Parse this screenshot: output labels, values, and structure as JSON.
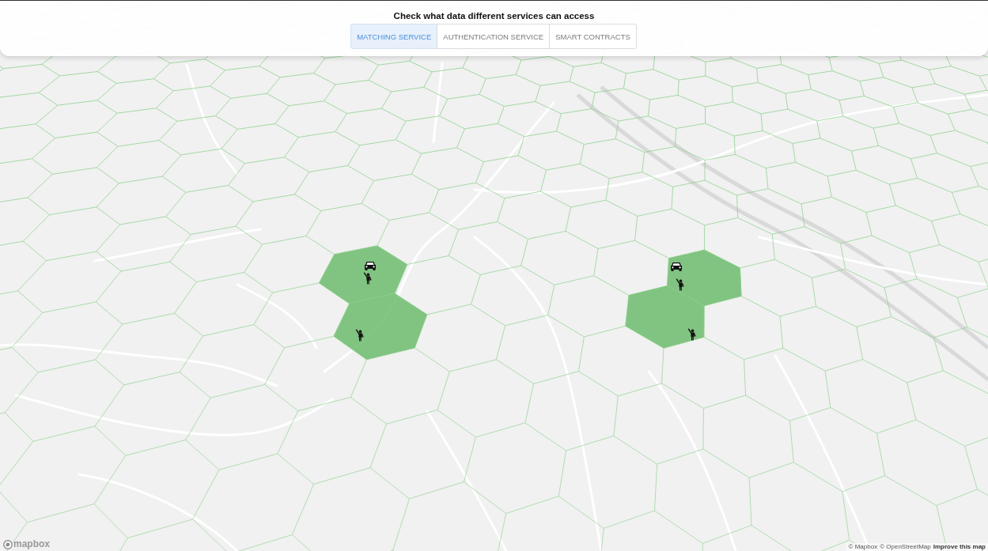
{
  "header": {
    "title": "Check what data different services can access",
    "tabs": [
      {
        "label": "MATCHING SERVICE",
        "selected": true
      },
      {
        "label": "AUTHENTICATION SERVICE",
        "selected": false
      },
      {
        "label": "SMART CONTRACTS",
        "selected": false
      }
    ]
  },
  "map": {
    "zones": [
      {
        "markers": [
          {
            "kind": "car"
          },
          {
            "kind": "person"
          }
        ]
      },
      {
        "markers": [
          {
            "kind": "person"
          }
        ]
      },
      {
        "markers": [
          {
            "kind": "car"
          },
          {
            "kind": "person"
          }
        ]
      },
      {
        "markers": [
          {
            "kind": "person"
          }
        ]
      }
    ]
  },
  "logo": {
    "text": "mapbox"
  },
  "attribution": {
    "links": [
      {
        "label": "© Mapbox",
        "kind": "credit"
      },
      {
        "label": "© OpenStreetMap",
        "kind": "credit"
      },
      {
        "label": "Improve this map",
        "kind": "action"
      }
    ]
  }
}
